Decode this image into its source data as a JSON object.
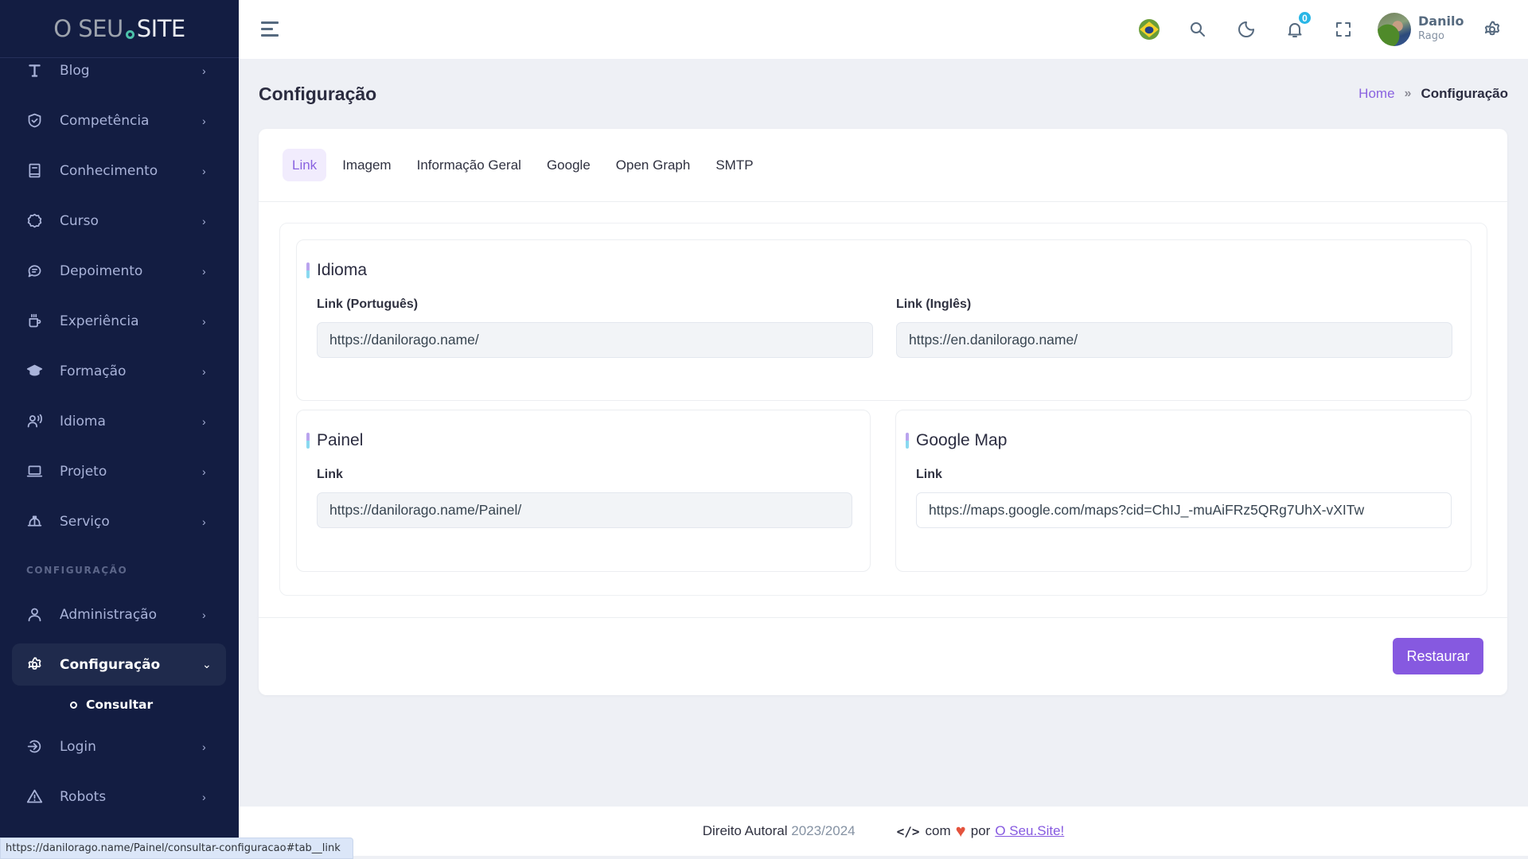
{
  "brand": {
    "part1": "O SEU",
    "part2": "SITE",
    "accent": "#4cc1a9"
  },
  "sidebar": {
    "items": [
      {
        "label": "Blog",
        "icon": "text-t-icon"
      },
      {
        "label": "Competência",
        "icon": "shield-check-icon"
      },
      {
        "label": "Conhecimento",
        "icon": "book-icon"
      },
      {
        "label": "Curso",
        "icon": "badge-icon"
      },
      {
        "label": "Depoimento",
        "icon": "message-icon"
      },
      {
        "label": "Experiência",
        "icon": "coffee-icon"
      },
      {
        "label": "Formação",
        "icon": "graduation-cap-icon"
      },
      {
        "label": "Idioma",
        "icon": "user-voice-icon"
      },
      {
        "label": "Projeto",
        "icon": "laptop-icon"
      },
      {
        "label": "Serviço",
        "icon": "helmet-icon"
      }
    ],
    "section_label": "CONFIGURAÇÃO",
    "config_items": [
      {
        "label": "Administração",
        "icon": "user-icon"
      },
      {
        "label": "Configuração",
        "icon": "gear-icon",
        "active": true,
        "children": [
          {
            "label": "Consultar"
          }
        ]
      },
      {
        "label": "Login",
        "icon": "login-icon"
      },
      {
        "label": "Robots",
        "icon": "warning-icon"
      }
    ]
  },
  "header": {
    "notification_count": "0",
    "user": {
      "first_name": "Danilo",
      "last_name": "Rago"
    }
  },
  "page": {
    "title": "Configuração",
    "breadcrumb": {
      "home": "Home",
      "current": "Configuração"
    }
  },
  "tabs": [
    {
      "label": "Link",
      "active": true
    },
    {
      "label": "Imagem"
    },
    {
      "label": "Informação Geral"
    },
    {
      "label": "Google"
    },
    {
      "label": "Open Graph"
    },
    {
      "label": "SMTP"
    }
  ],
  "sections": {
    "idioma": {
      "title": "Idioma",
      "pt_label": "Link (Português)",
      "pt_value": "https://danilorago.name/",
      "en_label": "Link (Inglês)",
      "en_value": "https://en.danilorago.name/"
    },
    "painel": {
      "title": "Painel",
      "label": "Link",
      "value": "https://danilorago.name/Painel/"
    },
    "google_map": {
      "title": "Google Map",
      "label": "Link",
      "value": "https://maps.google.com/maps?cid=ChIJ_-muAiFRz5QRg7UhX-vXITw"
    }
  },
  "actions": {
    "restore_label": "Restaurar",
    "accent": "#8659e0"
  },
  "footer": {
    "copyright": "Direito Autoral",
    "years": "2023/2024",
    "code_glyph": "</>",
    "with": "com",
    "by": "por",
    "link_label": "O Seu.Site!"
  },
  "status_bar": {
    "url": "https://danilorago.name/Painel/consultar-configuracao#tab__link"
  }
}
